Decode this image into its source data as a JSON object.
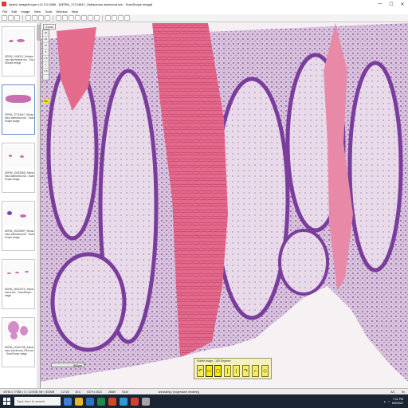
{
  "window": {
    "title": "Aperio ImageScope v12.3.0.5056 - [DERM_1712464?_Sebaceous adenoma.svs - ScanScope image]",
    "minimize": "—",
    "maximize": "☐",
    "close": "✕"
  },
  "menu": {
    "items": [
      "File",
      "Edit",
      "Image",
      "View",
      "Tools",
      "Window",
      "Help"
    ]
  },
  "toolbar": {
    "icons": [
      "open-icon",
      "save-icon",
      "print-icon",
      "copy-icon",
      "zoom-in-icon",
      "zoom-out-icon",
      "fit-icon",
      "hand-icon",
      "pen-icon",
      "rect-icon",
      "ellipse-icon",
      "arrow-icon",
      "ruler-icon",
      "text-icon",
      "layers-icon",
      "rotate-icon",
      "settings-icon",
      "help-icon"
    ]
  },
  "thumbnails": [
    {
      "label": "DERM_1404211_Sebaceous hyperplasia.svs - ScanScope image"
    },
    {
      "label": "DERM_1712464?_Sebaceous adenoma.svs - ScanScope image"
    },
    {
      "label": "DERM_1003336B_Sebaceous adenoma.svs - ScanScope image"
    },
    {
      "label": "DERM_1912969F_Sebaceous adenoma.svs - ScanScope image"
    },
    {
      "label": "DERM_1801337E_Sebaceoma.svs - ScanScope image"
    },
    {
      "label": "DERM_1914073B_Sebaceous carcinoma_HEs.svs - ScanScope image"
    }
  ],
  "viewer": {
    "zoom_label": "Zoom",
    "zoom_steps": [
      "40",
      "20",
      "10",
      "5",
      "2.5",
      "1",
      "0.5"
    ],
    "zoom_current": "15x",
    "scalebar_label": "500µm"
  },
  "rotate_panel": {
    "title": "Rotate image - 180 Degrees",
    "buttons": [
      "↶",
      "▭",
      "◻",
      "[",
      "(",
      "↷",
      "⌐",
      "◇"
    ]
  },
  "status": {
    "size": "49784 x 77088 x 3 = 10.9GB, file = 603MB",
    "zoom": "1:2728",
    "coords": "40.6",
    "loc": "5379 x 2623",
    "px": "25569",
    "py": "5440",
    "mode": "annotating / progressive rendering",
    "cap": "A/C",
    "lang": "En"
  },
  "taskbar": {
    "search_placeholder": "Type here to search",
    "time": "7:11 PM",
    "date": "6/5/2022"
  }
}
